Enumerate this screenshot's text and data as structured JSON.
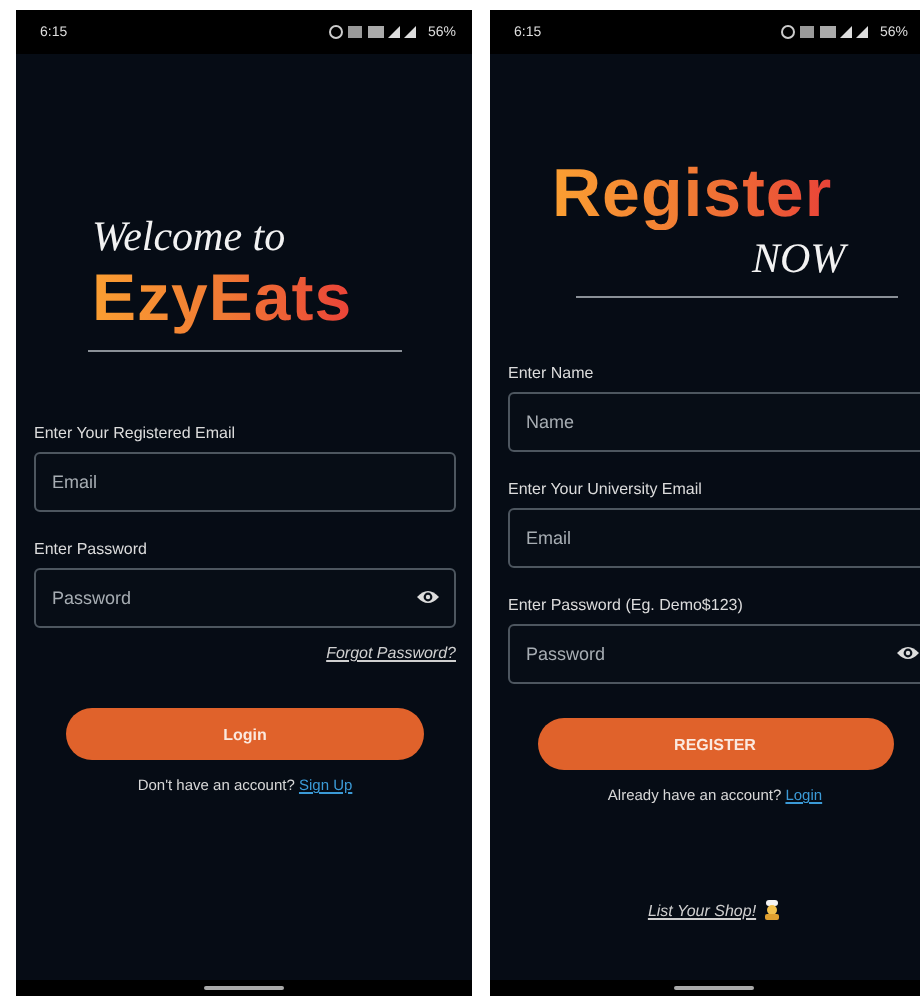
{
  "screens": [
    {
      "kind": "login",
      "status_bar": {
        "time": "6:15",
        "battery": "56%"
      },
      "heading": {
        "script": "Welcome to",
        "brand": "EzyEats"
      },
      "fields": [
        {
          "label": "Enter Your Registered Email",
          "placeholder": "Email",
          "password": false
        },
        {
          "label": "Enter Password",
          "placeholder": "Password",
          "password": true
        }
      ],
      "forgot_link": "Forgot Password?",
      "button": "Login",
      "prompt": {
        "text": "Don't have an account?",
        "link": "Sign Up"
      }
    },
    {
      "kind": "register",
      "status_bar": {
        "time": "6:15",
        "battery": "56%"
      },
      "heading": {
        "brand": "Register",
        "script": "NOW"
      },
      "fields": [
        {
          "label": "Enter Name",
          "placeholder": "Name",
          "password": false
        },
        {
          "label": "Enter Your University Email",
          "placeholder": "Email",
          "password": false
        },
        {
          "label": "Enter Password (Eg. Demo$123)",
          "placeholder": "Password",
          "password": true
        }
      ],
      "button": "REGISTER",
      "prompt": {
        "text": "Already have an account?",
        "link": "Login"
      },
      "shop_link": "List Your Shop!"
    }
  ]
}
